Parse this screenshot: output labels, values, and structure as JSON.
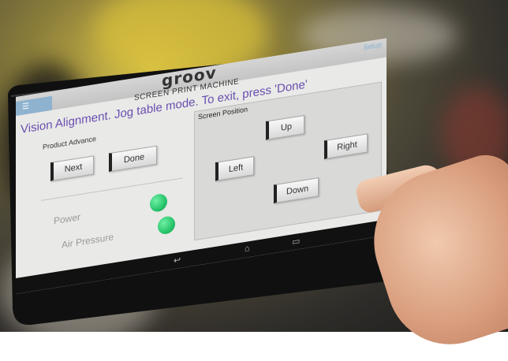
{
  "hmi": {
    "logo": "groov",
    "setup": "Setup",
    "machine_title": "SCREEN PRINT MACHINE",
    "status_message": "Vision Alignment. Jog table mode. To exit, press 'Done'",
    "product_advance": {
      "label": "Product Advance",
      "next_label": "Next",
      "done_label": "Done"
    },
    "indicators": [
      {
        "label": "Power",
        "state": "on",
        "color": "#2ecc71"
      },
      {
        "label": "Air Pressure",
        "state": "on",
        "color": "#2ecc71"
      }
    ],
    "screen_position": {
      "title": "Screen Position",
      "up_label": "Up",
      "left_label": "Left",
      "right_label": "Right",
      "down_label": "Down"
    }
  },
  "colors": {
    "status_text": "#6a4fb0",
    "led_on": "#2ecc71",
    "menu_tab": "#8fb3cf",
    "bezel": "#101010"
  },
  "icons": {
    "menu": "menu-icon",
    "settings": "gear-icon",
    "nav_back": "back-icon",
    "nav_home": "home-icon",
    "nav_recent": "recent-apps-icon"
  }
}
